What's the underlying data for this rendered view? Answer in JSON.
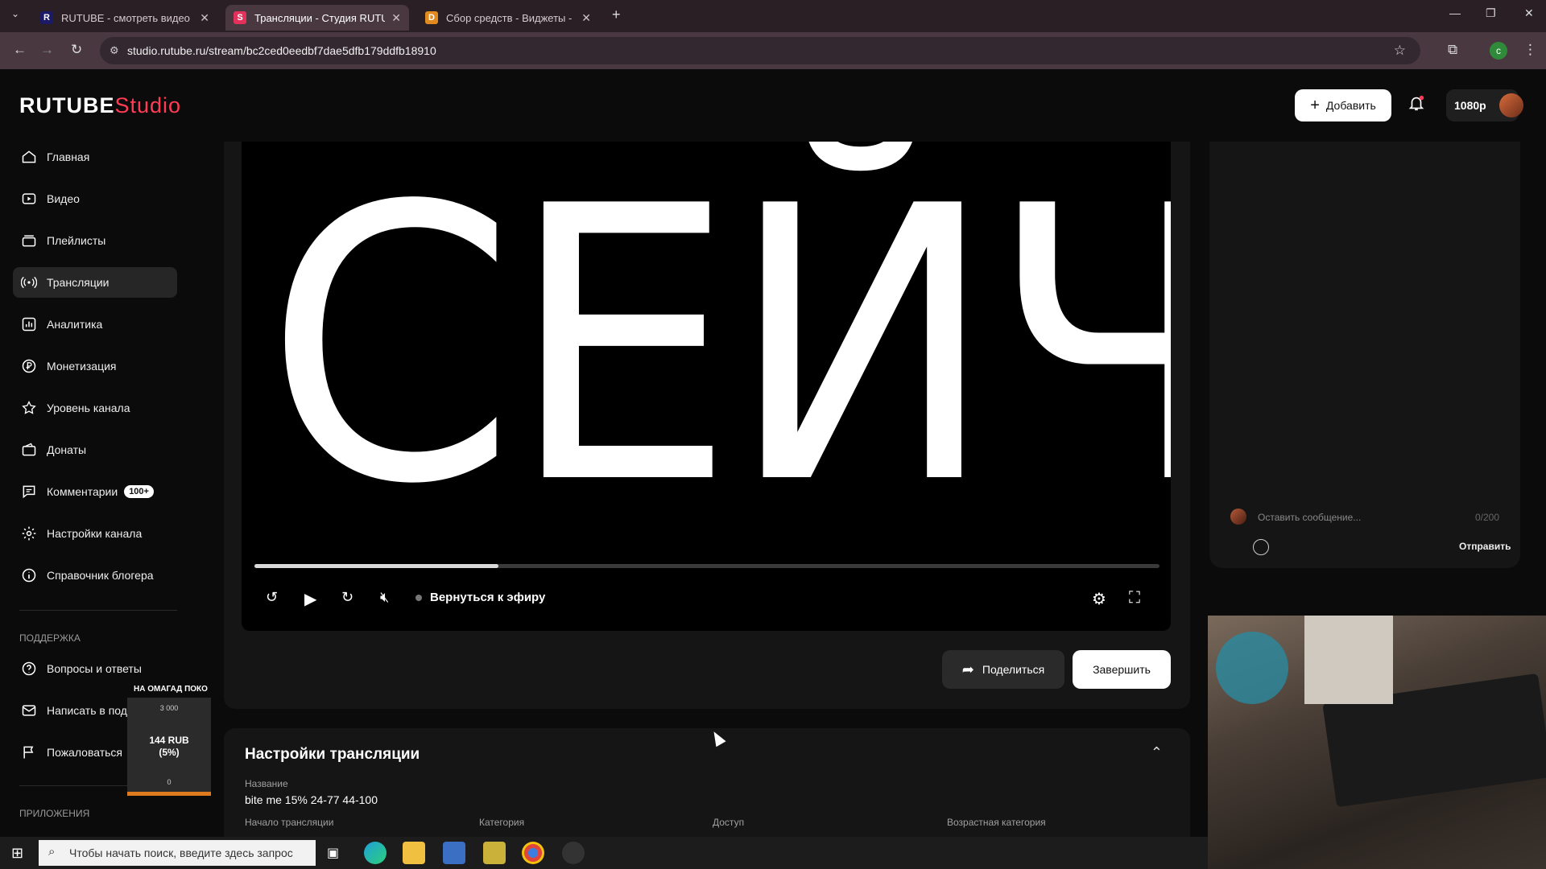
{
  "browser": {
    "tabs": [
      {
        "title": "RUTUBE - смотреть видео онл",
        "favicon": "R",
        "color": "#1a1a66"
      },
      {
        "title": "Трансляции - Студия RUTUBE",
        "favicon": "S",
        "color": "#e2315a"
      },
      {
        "title": "Сбор средств - Виджеты - Don",
        "favicon": "D",
        "color": "#e08a1f"
      }
    ],
    "url": "studio.rutube.ru/stream/bc2ced0eedbf7dae5dfb179ddfb18910"
  },
  "header": {
    "logo_main": "RUTUBE",
    "logo_studio": "Studio",
    "add_label": "Добавить",
    "quality": "1080p"
  },
  "sidebar": {
    "items": [
      {
        "label": "Главная",
        "icon": "home-icon"
      },
      {
        "label": "Видео",
        "icon": "video-icon"
      },
      {
        "label": "Плейлисты",
        "icon": "playlist-icon"
      },
      {
        "label": "Трансляции",
        "icon": "broadcast-icon"
      },
      {
        "label": "Аналитика",
        "icon": "analytics-icon"
      },
      {
        "label": "Монетизация",
        "icon": "ruble-icon"
      },
      {
        "label": "Уровень канала",
        "icon": "star-icon"
      },
      {
        "label": "Донаты",
        "icon": "wallet-icon"
      },
      {
        "label": "Комментарии",
        "icon": "comment-icon",
        "badge": "100+"
      },
      {
        "label": "Настройки канала",
        "icon": "gear-icon"
      },
      {
        "label": "Справочник блогера",
        "icon": "info-icon"
      }
    ],
    "support_title": "ПОДДЕРЖКА",
    "support_items": [
      {
        "label": "Вопросы и ответы",
        "icon": "question-icon"
      },
      {
        "label": "Написать в под",
        "icon": "mail-icon"
      },
      {
        "label": "Пожаловаться",
        "icon": "flag-icon"
      }
    ],
    "apps_title": "ПРИЛОЖЕНИЯ"
  },
  "player": {
    "overlay_text": "СЕЙЧАС",
    "progress": 0.27,
    "back_to_live": "Вернуться к эфиру",
    "share": "Поделиться",
    "finish": "Завершить"
  },
  "settings": {
    "title": "Настройки трансляции",
    "name_label": "Название",
    "name_value": "bite me 15% 24-77 44-100",
    "start_label": "Начало трансляции",
    "category_label": "Категория",
    "access_label": "Доступ",
    "age_label": "Возрастная категория"
  },
  "chat": {
    "placeholder": "Оставить сообщение...",
    "counter": "0/200",
    "send": "Отправить"
  },
  "donation_widget": {
    "title": "НА ОМАГАД ПОКО",
    "goal": "3 000",
    "amount": "144 RUB",
    "percent": "(5%)",
    "start": "0"
  },
  "taskbar": {
    "search_placeholder": "Чтобы начать поиск, введите здесь запрос"
  }
}
